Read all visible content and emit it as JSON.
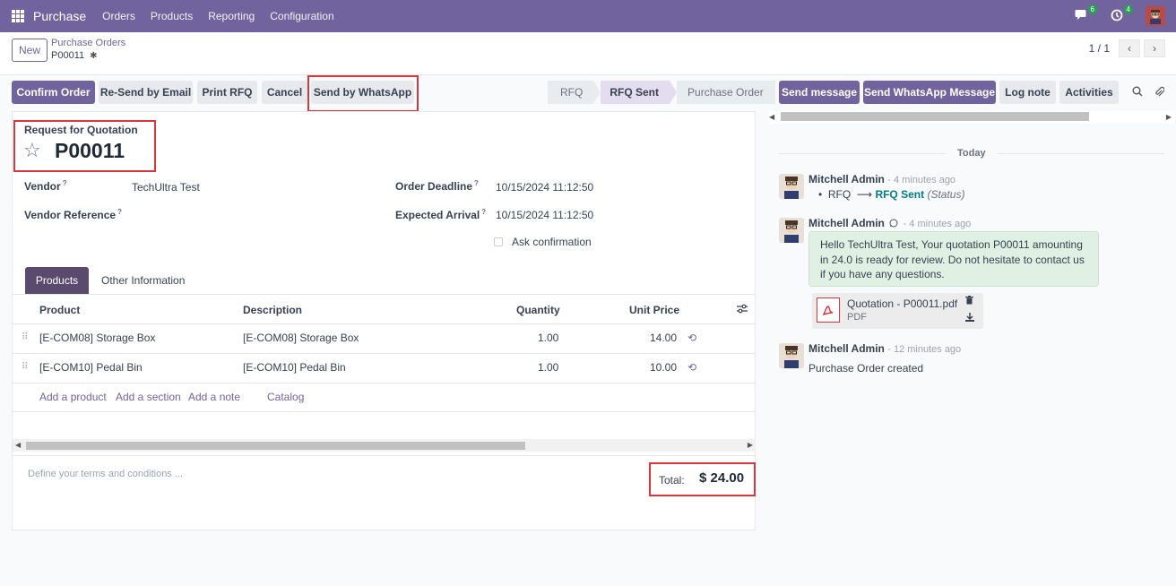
{
  "navbar": {
    "app": "Purchase",
    "menu": [
      "Orders",
      "Products",
      "Reporting",
      "Configuration"
    ],
    "messages_badge": "6",
    "activities_badge": "4"
  },
  "controlbar": {
    "new_label": "New",
    "breadcrumb": "Purchase Orders",
    "record": "P00011",
    "pager": "1 / 1"
  },
  "actions": {
    "confirm": "Confirm Order",
    "resend": "Re-Send by Email",
    "print": "Print RFQ",
    "cancel": "Cancel",
    "whatsapp": "Send by WhatsApp"
  },
  "status": {
    "stages": [
      "RFQ",
      "RFQ Sent",
      "Purchase Order"
    ],
    "active": "RFQ Sent"
  },
  "form": {
    "doc_type": "Request for Quotation",
    "name": "P00011",
    "vendor_label": "Vendor",
    "vendor": "TechUltra Test",
    "vendor_ref_label": "Vendor Reference",
    "deadline_label": "Order Deadline",
    "deadline": "10/15/2024 11:12:50",
    "arrival_label": "Expected Arrival",
    "arrival": "10/15/2024 11:12:50",
    "ask_confirmation": "Ask confirmation",
    "help": "?"
  },
  "tabs": {
    "products": "Products",
    "other": "Other Information"
  },
  "lines": {
    "headers": {
      "product": "Product",
      "description": "Description",
      "quantity": "Quantity",
      "unit_price": "Unit Price"
    },
    "rows": [
      {
        "product": "[E-COM08] Storage Box",
        "description": "[E-COM08] Storage Box",
        "quantity": "1.00",
        "unit_price": "14.00"
      },
      {
        "product": "[E-COM10] Pedal Bin",
        "description": "[E-COM10] Pedal Bin",
        "quantity": "1.00",
        "unit_price": "10.00"
      }
    ],
    "add_product": "Add a product",
    "add_section": "Add a section",
    "add_note": "Add a note",
    "catalog": "Catalog"
  },
  "footer": {
    "terms_placeholder": "Define your terms and conditions ...",
    "total_label": "Total:",
    "total_value": "$ 24.00"
  },
  "chatter": {
    "send_message": "Send message",
    "send_whatsapp": "Send WhatsApp Message",
    "log_note": "Log note",
    "activities": "Activities",
    "today": "Today",
    "messages": [
      {
        "author": "Mitchell Admin",
        "time": "- 4 minutes ago",
        "from": "RFQ",
        "to": "RFQ Sent",
        "field": "(Status)"
      },
      {
        "author": "Mitchell Admin",
        "time": "- 4 minutes ago",
        "body": "Hello TechUltra Test, Your quotation P00011 amounting in 24.0 is ready for review. Do not hesitate to contact us if you have any questions.",
        "attachment": "Quotation - P00011.pdf",
        "attachment_type": "PDF"
      },
      {
        "author": "Mitchell Admin",
        "time": "- 12 minutes ago",
        "body": "Purchase Order created"
      }
    ]
  }
}
